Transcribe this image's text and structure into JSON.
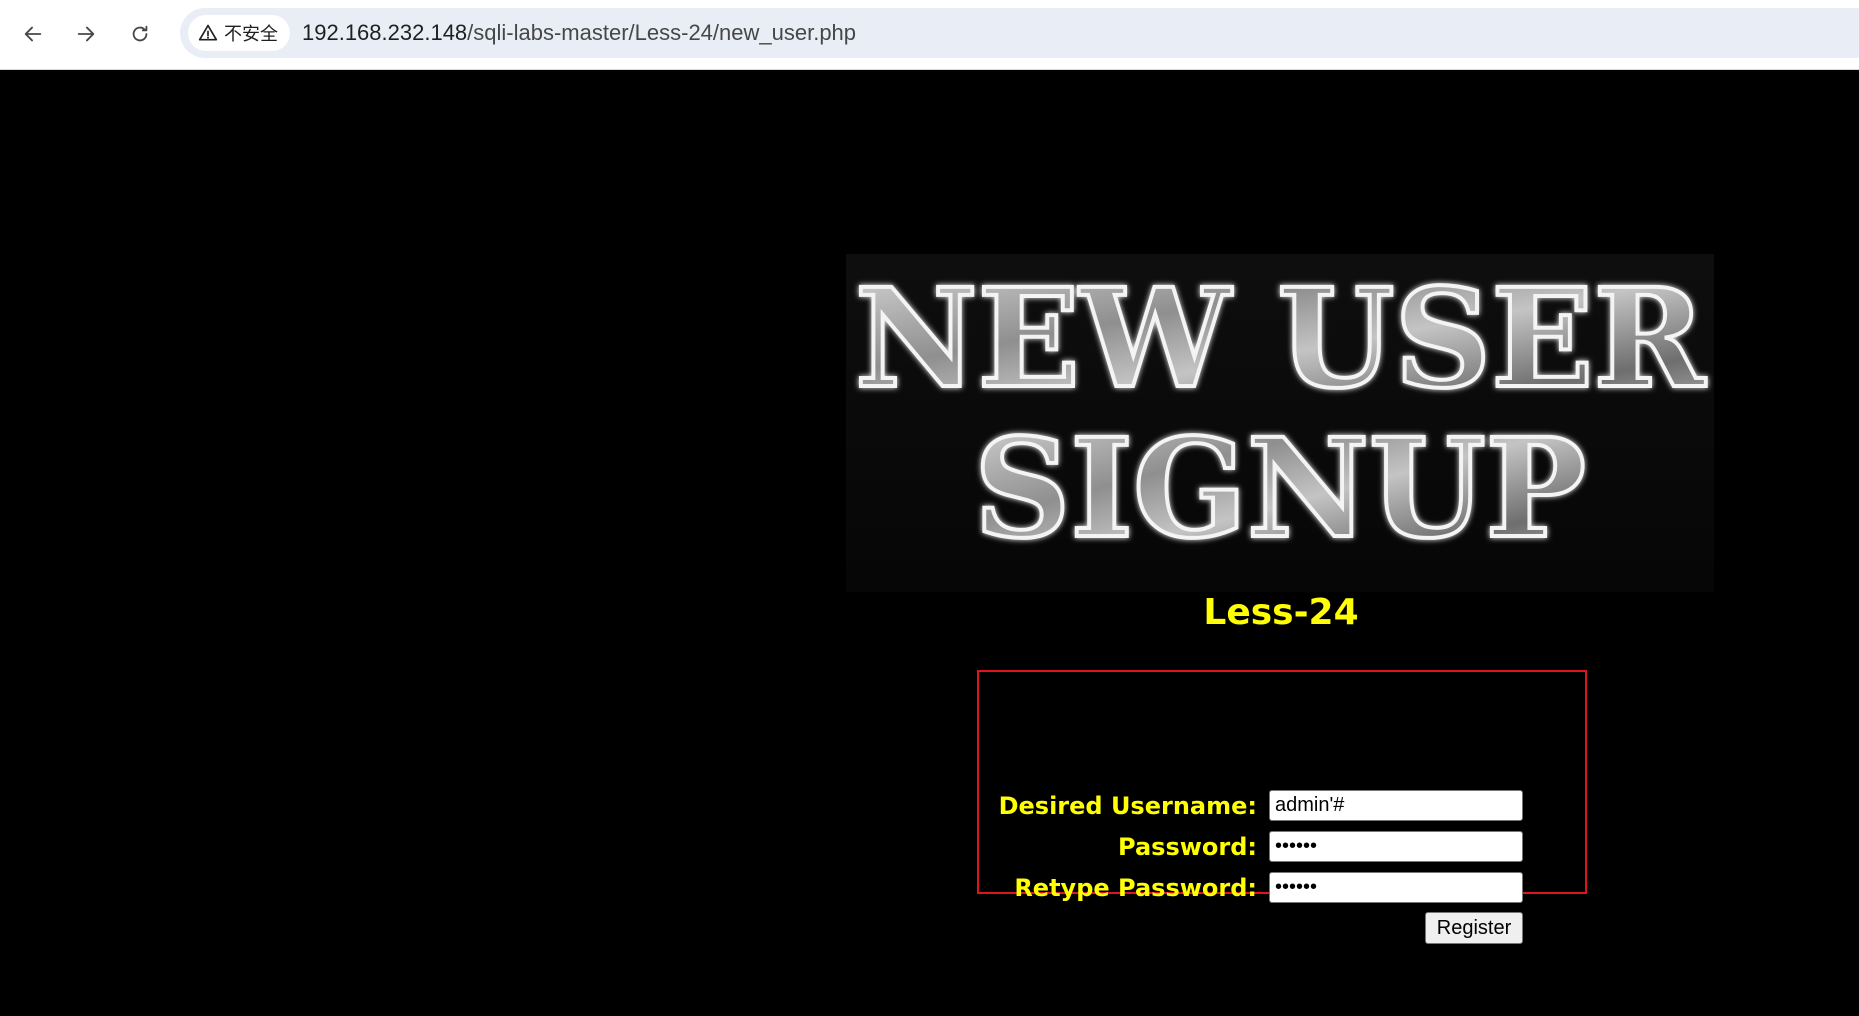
{
  "browser": {
    "security_label": "不安全",
    "url_host": "192.168.232.148",
    "url_path": "/sqli-labs-master/Less-24/new_user.php"
  },
  "banner": {
    "line1": "NEW USER",
    "line2": "SIGNUP"
  },
  "lesson_title": "Less-24",
  "form": {
    "username_label": "Desired Username:",
    "username_value": "admin'#",
    "password_label": "Password:",
    "password_value": "••••••",
    "retype_label": "Retype Password:",
    "retype_value": "••••••",
    "register_label": "Register"
  },
  "colors": {
    "page_background": "#000000",
    "label_color": "#ffff00",
    "form_border": "#e0141e"
  }
}
